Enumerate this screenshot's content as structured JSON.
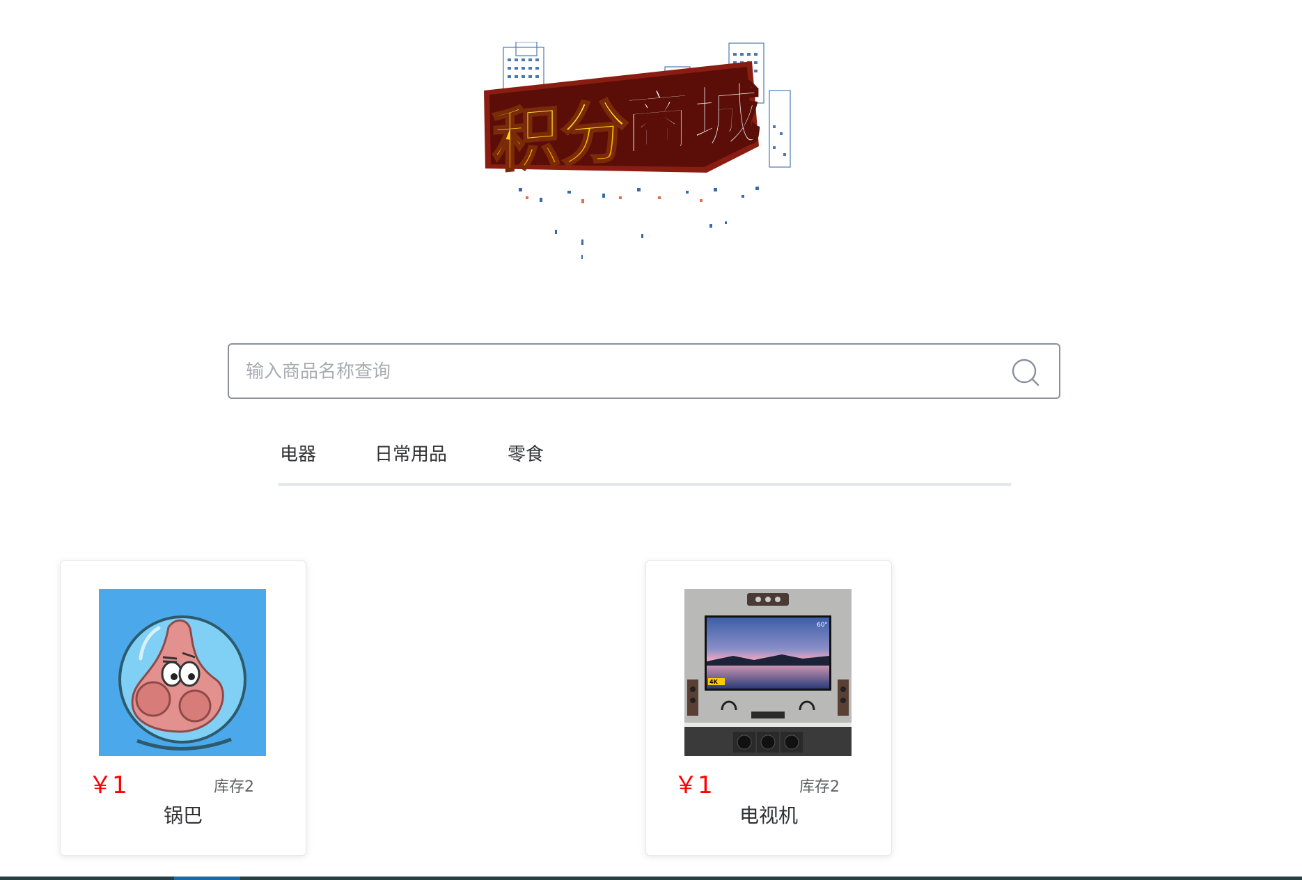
{
  "logo": {
    "text": "积分商城"
  },
  "search": {
    "placeholder": "输入商品名称查询",
    "value": "",
    "icon": "search-icon"
  },
  "tabs": [
    {
      "label": "电器"
    },
    {
      "label": "日常用品"
    },
    {
      "label": "零食"
    }
  ],
  "products": [
    {
      "price": "￥1",
      "stock": "库存2",
      "name": "锅巴",
      "image": "cartoon-starfish-astronaut"
    },
    {
      "price": "￥1",
      "stock": "库存2",
      "name": "电视机",
      "image": "wall-mounted-tv"
    }
  ],
  "tv_image": {
    "size_label": "60\"",
    "badge": "4K"
  },
  "colors": {
    "price": "#ff0000",
    "search_border": "#8a8f9e",
    "tab_underline": "#e4e7ed",
    "bottom_bar": "#263f45",
    "bottom_accent": "#1c6aa0"
  }
}
